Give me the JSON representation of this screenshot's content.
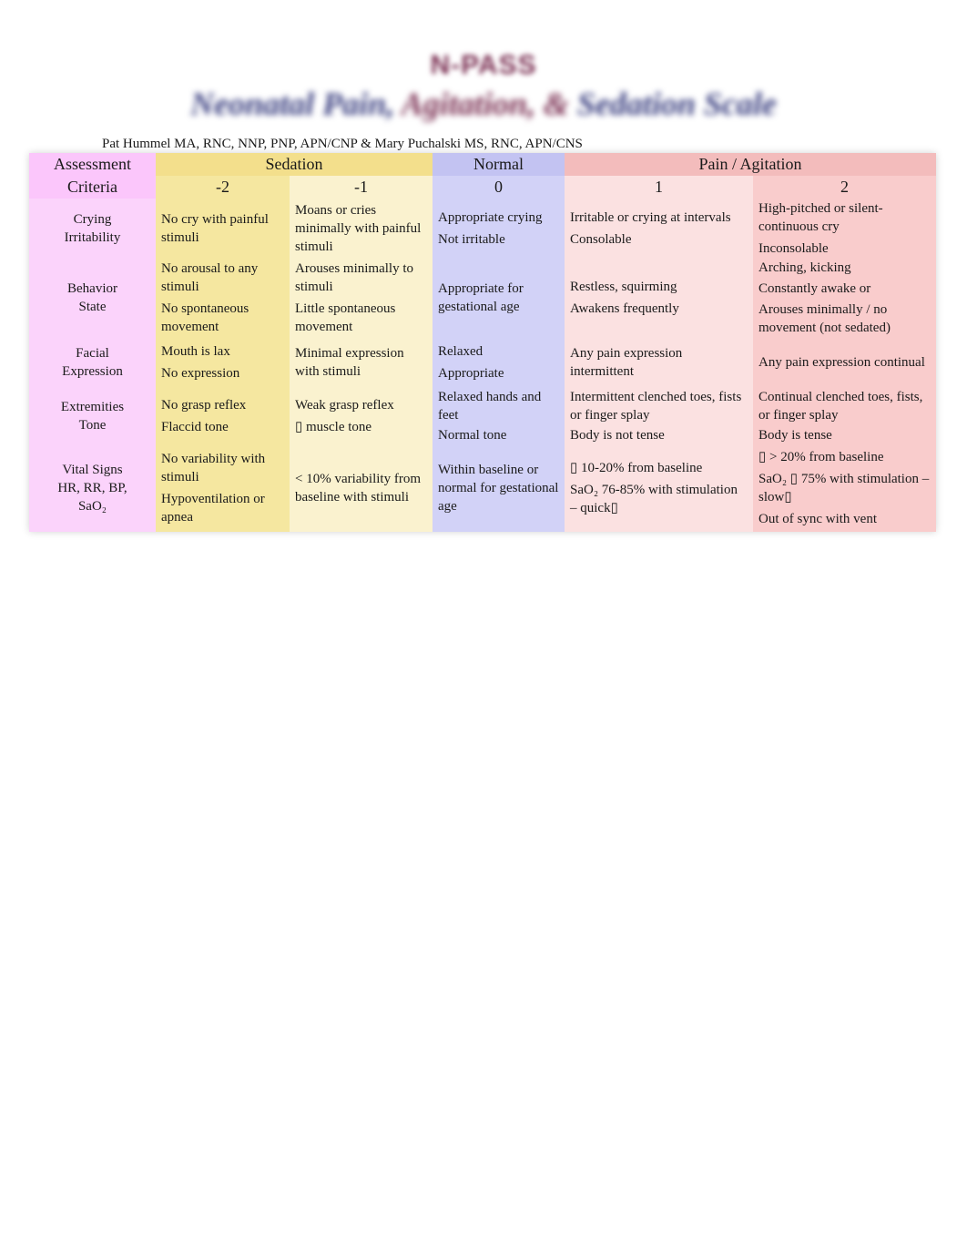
{
  "title": {
    "acronym": "N-PASS",
    "full_part1": "Neonatal Pain,",
    "full_part2": "Agitation,",
    "full_part3": "&",
    "full_part4": "Sedation Scale"
  },
  "authors": "Pat Hummel MA, RNC, NNP, PNP, APN/CNP & Mary Puchalski MS, RNC, APN/CNS",
  "colors": {
    "criteria": "#fbd3fb",
    "sedation": "#f5e7a0",
    "normal": "#d2d2f7",
    "pain": "#f9cccc",
    "title_maroon": "#7a2f52",
    "title_blue": "#3a3f80"
  },
  "table": {
    "header": {
      "criteria_line1": "Assessment",
      "criteria_line2": "Criteria",
      "sedation": "Sedation",
      "normal": "Normal",
      "pain": "Pain / Agitation",
      "scores": [
        "-2",
        "-1",
        "0",
        "1",
        "2"
      ]
    },
    "rows": [
      {
        "criteria": [
          "Crying",
          "Irritability"
        ],
        "cells": [
          [
            "No cry with painful stimuli"
          ],
          [
            "Moans or cries minimally with painful stimuli"
          ],
          [
            "Appropriate crying",
            "Not irritable"
          ],
          [
            "Irritable or crying at intervals",
            "Consolable"
          ],
          [
            "High-pitched or      silent-continuous cry",
            "Inconsolable"
          ]
        ]
      },
      {
        "criteria": [
          "Behavior",
          "State"
        ],
        "cells": [
          [
            "No arousal to any stimuli",
            "No spontaneous movement"
          ],
          [
            "Arouses minimally to stimuli",
            "Little spontaneous movement"
          ],
          [
            "Appropriate for gestational age"
          ],
          [
            "Restless, squirming",
            "Awakens frequently"
          ],
          [
            "Arching, kicking",
            "Constantly awake or",
            "Arouses minimally / no movement (not sedated)"
          ]
        ]
      },
      {
        "criteria": [
          "Facial",
          "Expression"
        ],
        "cells": [
          [
            "Mouth is lax",
            "No expression"
          ],
          [
            "Minimal expression with stimuli"
          ],
          [
            "Relaxed",
            "Appropriate"
          ],
          [
            "Any pain expression intermittent"
          ],
          [
            "Any pain expression continual"
          ]
        ]
      },
      {
        "criteria": [
          "Extremities",
          "Tone"
        ],
        "cells": [
          [
            "No grasp reflex",
            "Flaccid tone"
          ],
          [
            "Weak grasp reflex",
            "▯  muscle tone"
          ],
          [
            "Relaxed hands and feet",
            "Normal tone"
          ],
          [
            "Intermittent clenched toes, fists or finger splay",
            "Body is not tense"
          ],
          [
            "Continual clenched toes, fists, or finger splay",
            "Body is tense"
          ]
        ]
      },
      {
        "criteria": [
          "Vital Signs",
          "HR, RR, BP,",
          "SaO₂"
        ],
        "cells": [
          [
            "No variability with stimuli",
            "Hypoventilation or apnea"
          ],
          [
            "< 10% variability from baseline with stimuli"
          ],
          [
            "Within baseline or normal for gestational age"
          ],
          [
            "▯ 10-20% from baseline",
            "SaO₂ 76-85% with stimulation – quick▯"
          ],
          [
            "▯ > 20% from baseline",
            "SaO₂ ▯  75% with stimulation – slow▯",
            "Out of sync with vent"
          ]
        ]
      }
    ]
  }
}
